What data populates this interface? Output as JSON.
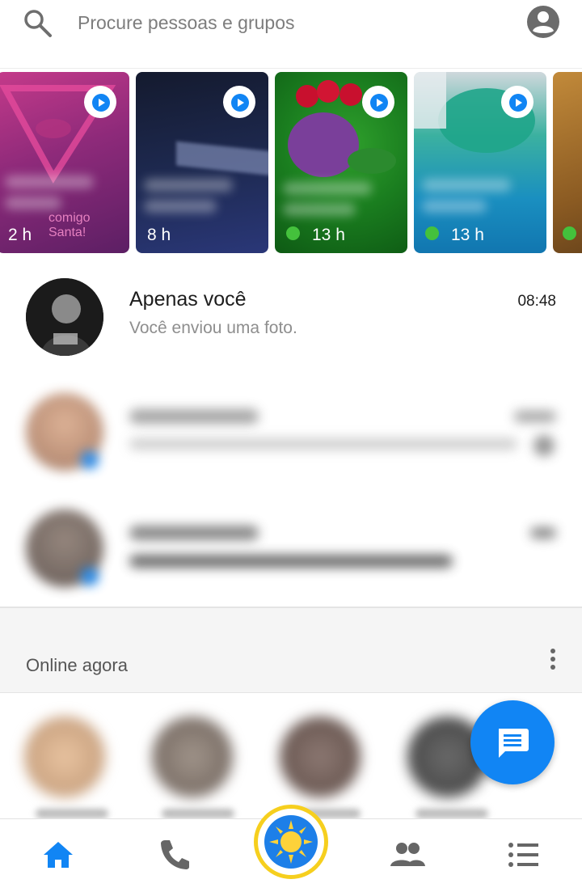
{
  "search": {
    "placeholder": "Procure pessoas e grupos"
  },
  "stories": [
    {
      "time": "2 h",
      "online": false,
      "overlay_text": "comigo Santa!"
    },
    {
      "time": "8 h",
      "online": false
    },
    {
      "time": "13 h",
      "online": true
    },
    {
      "time": "13 h",
      "online": true
    }
  ],
  "conversations": [
    {
      "name": "Apenas você",
      "preview": "Você enviou uma foto.",
      "time": "08:48"
    }
  ],
  "online_section": {
    "title": "Online agora"
  },
  "icons": {
    "search": "search-icon",
    "profile": "profile-icon",
    "play": "play-icon",
    "more": "more-vertical-icon",
    "compose": "compose-message-icon",
    "home": "home-icon",
    "calls": "phone-icon",
    "camera": "camera-sun-icon",
    "people": "people-icon",
    "menu": "list-icon"
  },
  "colors": {
    "accent": "#1185f4",
    "online_dot": "#44c13c",
    "camera_ring": "#f6cf1e"
  }
}
